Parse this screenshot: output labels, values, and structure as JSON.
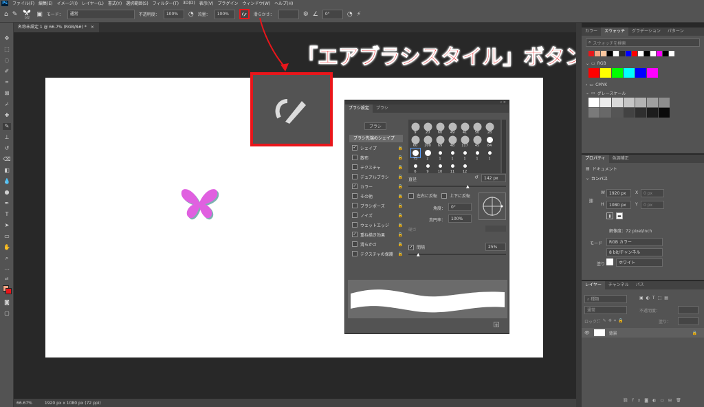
{
  "menubar": {
    "logo": "Ps",
    "items": [
      "ファイル(F)",
      "編集(E)",
      "イメージ(I)",
      "レイヤー(L)",
      "書式(Y)",
      "選択範囲(S)",
      "フィルター(T)",
      "3D(D)",
      "表示(V)",
      "プラグイン",
      "ウィンドウ(W)",
      "ヘルプ(H)"
    ]
  },
  "options": {
    "brush_size": "142",
    "mode_label": "モード：",
    "mode_value": "通常",
    "opacity_label": "不透明度：",
    "opacity_value": "100%",
    "flow_label": "流量：",
    "flow_value": "100%",
    "smoothing_label": "滑らかさ：",
    "smoothing_value": "",
    "angle_value": "0°"
  },
  "document": {
    "tab_title": "名称未設定 1 @ 66.7% (RGB/8#) *",
    "close": "×"
  },
  "status": {
    "zoom": "66.67%",
    "info": "1920 px x 1080 px (72 ppi)"
  },
  "annotation": {
    "callout": "「エアブラシスタイル」ボタン",
    "color": "#e8161b"
  },
  "brushpanel": {
    "tabs": [
      "ブラシ設定",
      "ブラシ"
    ],
    "brushes_button": "ブラシ",
    "tip_shape": "ブラシ先端のシェイプ",
    "options": [
      {
        "label": "シェイプ",
        "checked": true
      },
      {
        "label": "散布",
        "checked": false
      },
      {
        "label": "テクスチャ",
        "checked": false
      },
      {
        "label": "デュアルブラシ",
        "checked": false
      },
      {
        "label": "カラー",
        "checked": true
      },
      {
        "label": "その他",
        "checked": false
      },
      {
        "label": "ブラシポーズ",
        "checked": false
      },
      {
        "label": "ノイズ",
        "checked": false
      },
      {
        "label": "ウェットエッジ",
        "checked": false
      },
      {
        "label": "重ね描き効果",
        "checked": true
      },
      {
        "label": "滑らかさ",
        "checked": false
      },
      {
        "label": "テクスチャの保護",
        "checked": false
      }
    ],
    "tip_sizes": [
      "9",
      "20",
      "60",
      "49",
      "41",
      "50",
      "28",
      "60",
      "200",
      "69",
      "48",
      "117",
      "45",
      "84",
      "75",
      "2",
      "1",
      "1",
      "1",
      "1",
      "1",
      "6",
      "9",
      "10",
      "11",
      "12"
    ],
    "size_label": "直径",
    "size_value": "142 px",
    "flipx": "左右に反転",
    "flipy": "上下に反転",
    "angle_label": "角度：",
    "angle_value": "0°",
    "roundness_label": "真円率：",
    "roundness_value": "100%",
    "hardness_label": "硬さ",
    "spacing_label": "間隔",
    "spacing_value": "25%",
    "check_mark": "✓",
    "add_icon": "+"
  },
  "swatches": {
    "tabs": [
      "カラー",
      "スウォッチ",
      "グラデーション",
      "パターン"
    ],
    "search_placeholder": "スウォッチを検索",
    "recent_colors": [
      "#e8161b",
      "#f6a483",
      "#f9c69e",
      "#000000",
      "#ffffff",
      "#2d2d2d",
      "#0000ff",
      "#ff0000",
      "#ffffff",
      "#000000",
      "#ffffff",
      "#ff00ff",
      "#000000",
      "#ffffff"
    ],
    "groups": [
      {
        "name": "RGB",
        "colors": [
          "#ff0000",
          "#ffff00",
          "#00ff00",
          "#00ffff",
          "#0000ff",
          "#ff00ff"
        ]
      },
      {
        "name": "CMYK",
        "colors": []
      },
      {
        "name": "グレースケール",
        "colors": [
          "#ffffff",
          "#ececec",
          "#d9d9d9",
          "#c6c6c6",
          "#b3b3b3",
          "#a0a0a0",
          "#8d8d8d",
          "#7a7a7a",
          "#686868",
          "#555555",
          "#424242",
          "#2f2f2f",
          "#1c1c1c",
          "#0a0a0a"
        ]
      }
    ]
  },
  "properties": {
    "tabs": [
      "プロパティ",
      "色調補正"
    ],
    "doc_label": "ドキュメント",
    "canvas_label": "カンバス",
    "w_label": "W",
    "w_value": "1920 px",
    "h_label": "H",
    "h_value": "1080 px",
    "x_label": "X",
    "x_value": "0 px",
    "y_label": "Y",
    "y_value": "0 px",
    "resolution": "解像度：72 pixel/inch",
    "mode_label": "モード",
    "mode_value": "RGB カラー",
    "bits_value": "8 bit/チャンネル",
    "fill_label": "塗り",
    "fill_value": "ホワイト"
  },
  "layers": {
    "tabs": [
      "レイヤー",
      "チャンネル",
      "パス"
    ],
    "kind_value": "種類",
    "blend_value": "通常",
    "opacity_label": "不透明度：",
    "lock_label": "ロック：",
    "fill_label": "塗り：",
    "items": [
      {
        "name": "背景"
      }
    ]
  }
}
